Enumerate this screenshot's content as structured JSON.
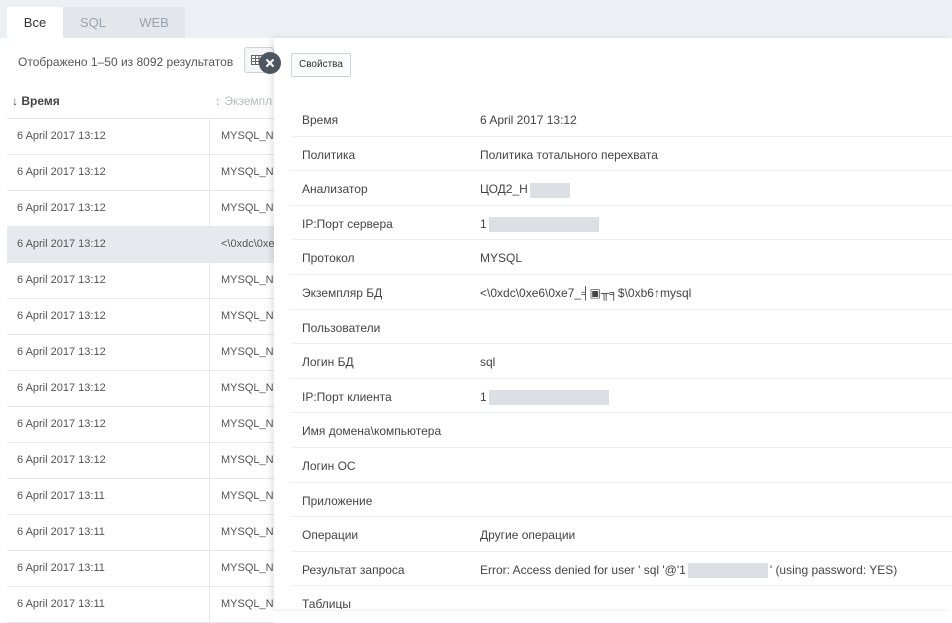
{
  "tabs": [
    {
      "label": "Все",
      "active": true
    },
    {
      "label": "SQL",
      "active": false
    },
    {
      "label": "WEB",
      "active": false
    }
  ],
  "results_count": "Отображено 1–50 из 8092 результатов",
  "icons": {
    "view_toggle": "table-grid-icon",
    "close": "close-icon",
    "sort": "sort-down-arrow-icon"
  },
  "list": {
    "columns": {
      "time": "Время",
      "instance": "Экземпл"
    },
    "rows": [
      {
        "time": "6 April 2017 13:12",
        "instance": "MYSQL_N",
        "selected": false
      },
      {
        "time": "6 April 2017 13:12",
        "instance": "MYSQL_N",
        "selected": false
      },
      {
        "time": "6 April 2017 13:12",
        "instance": "MYSQL_N",
        "selected": false
      },
      {
        "time": "6 April 2017 13:12",
        "instance": "<\\0xdc\\0xe",
        "selected": true
      },
      {
        "time": "6 April 2017 13:12",
        "instance": "MYSQL_N",
        "selected": false
      },
      {
        "time": "6 April 2017 13:12",
        "instance": "MYSQL_N",
        "selected": false
      },
      {
        "time": "6 April 2017 13:12",
        "instance": "MYSQL_N",
        "selected": false
      },
      {
        "time": "6 April 2017 13:12",
        "instance": "MYSQL_N",
        "selected": false
      },
      {
        "time": "6 April 2017 13:12",
        "instance": "MYSQL_N",
        "selected": false
      },
      {
        "time": "6 April 2017 13:12",
        "instance": "MYSQL_N",
        "selected": false
      },
      {
        "time": "6 April 2017 13:11",
        "instance": "MYSQL_N",
        "selected": false
      },
      {
        "time": "6 April 2017 13:11",
        "instance": "MYSQL_N",
        "selected": false
      },
      {
        "time": "6 April 2017 13:11",
        "instance": "MYSQL_N",
        "selected": false
      },
      {
        "time": "6 April 2017 13:11",
        "instance": "MYSQL_N",
        "selected": false
      }
    ]
  },
  "panel": {
    "tab_label": "Свойства",
    "properties": [
      {
        "key": "Время",
        "value": "6 April 2017 13:12"
      },
      {
        "key": "Политика",
        "value": "Политика тотального перехвата"
      },
      {
        "key": "Анализатор",
        "value": "ЦОД2_Н"
      },
      {
        "key": "IP:Порт сервера",
        "value": "1"
      },
      {
        "key": "Протокол",
        "value": "MYSQL"
      },
      {
        "key": "Экземпляр БД",
        "value": "<\\0xdc\\0xe6\\0xe7_╡▣╥╕$\\0xb6↑mysql"
      },
      {
        "key": "Пользователи",
        "value": ""
      },
      {
        "key": "Логин БД",
        "value": "sql"
      },
      {
        "key": "IP:Порт клиента",
        "value": "1"
      },
      {
        "key": "Имя домена\\компьютера",
        "value": ""
      },
      {
        "key": "Логин ОС",
        "value": ""
      },
      {
        "key": "Приложение",
        "value": ""
      },
      {
        "key": "Операции",
        "value": "Другие операции"
      },
      {
        "key": "Результат запроса",
        "value": "Error: Access denied for user ' sql '@'1",
        "value_tail": "' (using password: YES)"
      },
      {
        "key": "Таблицы",
        "value": ""
      }
    ]
  }
}
